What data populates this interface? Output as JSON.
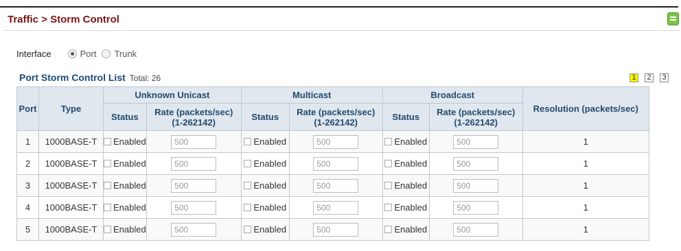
{
  "header": {
    "breadcrumb": "Traffic > Storm Control",
    "save_icon": "save-icon"
  },
  "interface": {
    "label": "Interface",
    "options": [
      {
        "label": "Port",
        "checked": true
      },
      {
        "label": "Trunk",
        "checked": false
      }
    ]
  },
  "list": {
    "title": "Port Storm Control List",
    "total_label": "Total: 26",
    "pages": [
      "1",
      "2",
      "3"
    ],
    "active_page": "1"
  },
  "table": {
    "groups": {
      "unicast": "Unknown Unicast",
      "multicast": "Multicast",
      "broadcast": "Broadcast"
    },
    "headers": {
      "port": "Port",
      "type": "Type",
      "status": "Status",
      "rate_line1": "Rate (packets/sec)",
      "rate_line2": "(1-262142)",
      "resolution": "Resolution (packets/sec)"
    },
    "rows": [
      {
        "port": "1",
        "type": "1000BASE-T",
        "uu_status": "Enabled",
        "uu_rate": "500",
        "mc_status": "Enabled",
        "mc_rate": "500",
        "bc_status": "Enabled",
        "bc_rate": "500",
        "resolution": "1"
      },
      {
        "port": "2",
        "type": "1000BASE-T",
        "uu_status": "Enabled",
        "uu_rate": "500",
        "mc_status": "Enabled",
        "mc_rate": "500",
        "bc_status": "Enabled",
        "bc_rate": "500",
        "resolution": "1"
      },
      {
        "port": "3",
        "type": "1000BASE-T",
        "uu_status": "Enabled",
        "uu_rate": "500",
        "mc_status": "Enabled",
        "mc_rate": "500",
        "bc_status": "Enabled",
        "bc_rate": "500",
        "resolution": "1"
      },
      {
        "port": "4",
        "type": "1000BASE-T",
        "uu_status": "Enabled",
        "uu_rate": "500",
        "mc_status": "Enabled",
        "mc_rate": "500",
        "bc_status": "Enabled",
        "bc_rate": "500",
        "resolution": "1"
      },
      {
        "port": "5",
        "type": "1000BASE-T",
        "uu_status": "Enabled",
        "uu_rate": "500",
        "mc_status": "Enabled",
        "mc_rate": "500",
        "bc_status": "Enabled",
        "bc_rate": "500",
        "resolution": "1"
      }
    ]
  }
}
